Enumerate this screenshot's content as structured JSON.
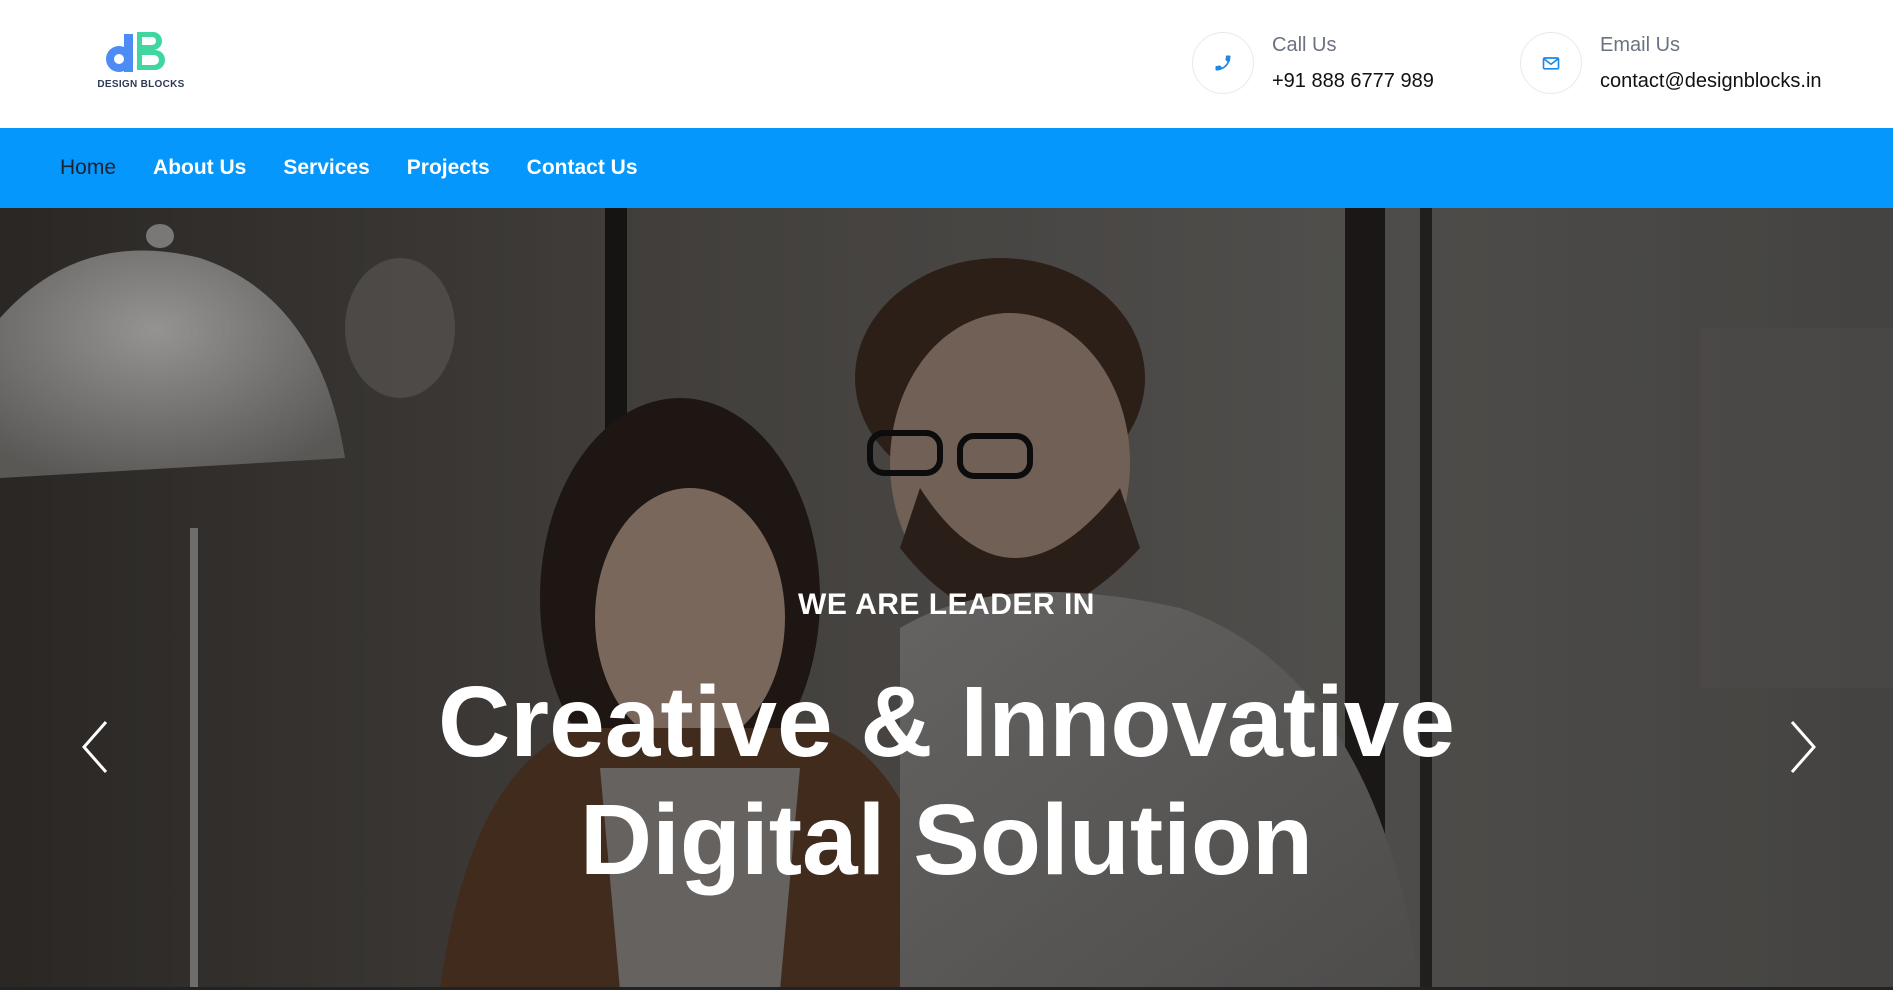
{
  "brand": {
    "logo_text": "DESIGN BLOCKS",
    "colors": {
      "mark_blue": "#4d8cf5",
      "mark_green": "#3fd6a0",
      "text": "#2d3b56"
    }
  },
  "contacts": {
    "call": {
      "icon": "phone-icon",
      "label": "Call Us",
      "value": "+91 888 6777 989"
    },
    "email": {
      "icon": "envelope-icon",
      "label": "Email Us",
      "value": "contact@designblocks.in"
    }
  },
  "nav": {
    "background": "#0597fc",
    "items": [
      {
        "label": "Home",
        "active": true
      },
      {
        "label": "About Us",
        "active": false
      },
      {
        "label": "Services",
        "active": false
      },
      {
        "label": "Projects",
        "active": false
      },
      {
        "label": "Contact Us",
        "active": false
      }
    ]
  },
  "hero": {
    "subtitle": "WE ARE LEADER IN",
    "title_line1": "Creative & Innovative",
    "title_line2": "Digital Solution",
    "prev_icon": "chevron-left-icon",
    "next_icon": "chevron-right-icon"
  },
  "theme": {
    "accent": "#0597fc",
    "icon_color": "#1e88e5"
  }
}
